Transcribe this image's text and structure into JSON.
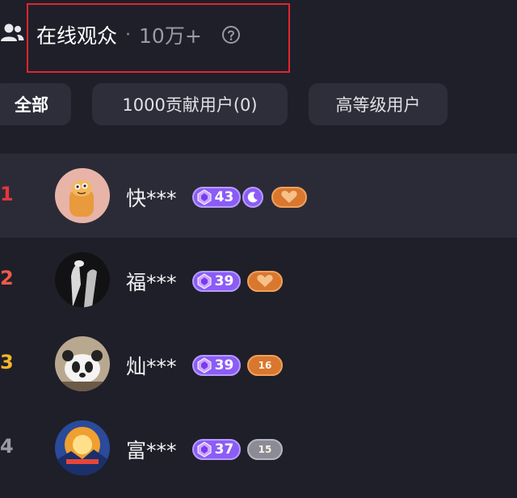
{
  "header": {
    "title": "在线观众",
    "separator": "·",
    "viewer_count": "10万+",
    "icons": {
      "people": "people-icon",
      "help": "help-circle-icon"
    }
  },
  "filters": [
    {
      "label": "全部",
      "active": true
    },
    {
      "label": "1000贡献用户(0)",
      "active": false
    },
    {
      "label": "高等级用户",
      "active": false
    }
  ],
  "viewers": [
    {
      "rank": "1",
      "rank_color": "#e8353b",
      "name": "快***",
      "level": "43",
      "has_moon_badge": true,
      "fan_badge": "",
      "fan_badge_color": "orange"
    },
    {
      "rank": "2",
      "rank_color": "#f05a4a",
      "name": "福***",
      "level": "39",
      "has_moon_badge": false,
      "fan_badge": "",
      "fan_badge_color": "orange"
    },
    {
      "rank": "3",
      "rank_color": "#f3b72b",
      "name": "灿***",
      "level": "39",
      "has_moon_badge": false,
      "fan_badge": "16",
      "fan_badge_color": "orange"
    },
    {
      "rank": "4",
      "rank_color": "#9a9aa6",
      "name": "富***",
      "level": "37",
      "has_moon_badge": false,
      "fan_badge": "15",
      "fan_badge_color": "grey"
    }
  ],
  "colors": {
    "background": "#1f1f29",
    "highlight_border": "#e0262e",
    "level_badge": "#8b5cf6",
    "fan_badge_orange": "#d9772f",
    "fan_badge_grey": "#8b8b95"
  }
}
